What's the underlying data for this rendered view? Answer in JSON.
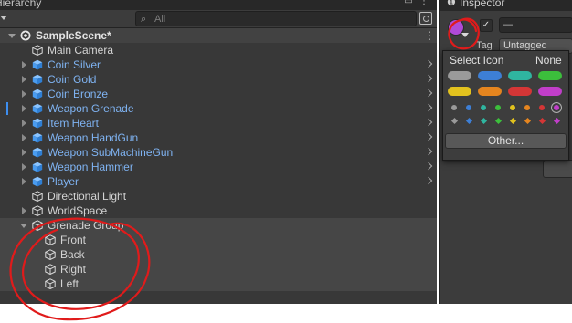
{
  "hierarchy": {
    "tab_title": "Hierarchy",
    "search_placeholder": "All",
    "scene_name": "SampleScene*",
    "items": [
      {
        "label": "Main Camera",
        "kind": "obj",
        "fold": "none"
      },
      {
        "label": "Coin Silver",
        "kind": "prefab",
        "fold": "closed",
        "arrow": true
      },
      {
        "label": "Coin Gold",
        "kind": "prefab",
        "fold": "closed",
        "arrow": true
      },
      {
        "label": "Coin Bronze",
        "kind": "prefab",
        "fold": "closed",
        "arrow": true
      },
      {
        "label": "Weapon Grenade",
        "kind": "prefab",
        "fold": "closed",
        "arrow": true,
        "marker": true
      },
      {
        "label": "Item Heart",
        "kind": "prefab",
        "fold": "closed",
        "arrow": true
      },
      {
        "label": "Weapon HandGun",
        "kind": "prefab",
        "fold": "closed",
        "arrow": true
      },
      {
        "label": "Weapon SubMachineGun",
        "kind": "prefab",
        "fold": "closed",
        "arrow": true
      },
      {
        "label": "Weapon Hammer",
        "kind": "prefab",
        "fold": "closed",
        "arrow": true
      },
      {
        "label": "Player",
        "kind": "prefab",
        "fold": "closed",
        "arrow": true
      },
      {
        "label": "Directional Light",
        "kind": "obj",
        "fold": "none"
      },
      {
        "label": "WorldSpace",
        "kind": "obj",
        "fold": "closed"
      },
      {
        "label": "Grenade Group",
        "kind": "obj",
        "fold": "open"
      },
      {
        "label": "Front",
        "kind": "obj",
        "fold": "none",
        "child": true
      },
      {
        "label": "Back",
        "kind": "obj",
        "fold": "none",
        "child": true
      },
      {
        "label": "Right",
        "kind": "obj",
        "fold": "none",
        "child": true
      },
      {
        "label": "Left",
        "kind": "obj",
        "fold": "none",
        "child": true
      }
    ]
  },
  "inspector": {
    "tab_title": "Inspector",
    "info_icon": "info-icon",
    "active_check": "✓",
    "name_value": "—",
    "tag_label": "Tag",
    "tag_value": "Untagged"
  },
  "select_icon_popup": {
    "title": "Select Icon",
    "none_label": "None",
    "other_button": "Other...",
    "pill_colors": [
      "#9a9a9a",
      "#3d7fd6",
      "#2fb5a0",
      "#3cbf3c",
      "#e2c21e",
      "#e5851f",
      "#d43636",
      "#c13ec9"
    ],
    "dot_colors": [
      "#9a9a9a",
      "#3d7fd6",
      "#2fb5a0",
      "#3cbf3c",
      "#e2c21e",
      "#e5851f",
      "#d43636",
      "#c13ec9"
    ],
    "diamond_colors": [
      "#9a9a9a",
      "#3d7fd6",
      "#2fb5a0",
      "#3cbf3c",
      "#e2c21e",
      "#e5851f",
      "#d43636",
      "#c13ec9"
    ],
    "selected_dot": 7
  },
  "colors": {
    "panel_bg": "#383838",
    "prefab_text": "#7fb3f2",
    "annotation_red": "#e01b1b"
  }
}
